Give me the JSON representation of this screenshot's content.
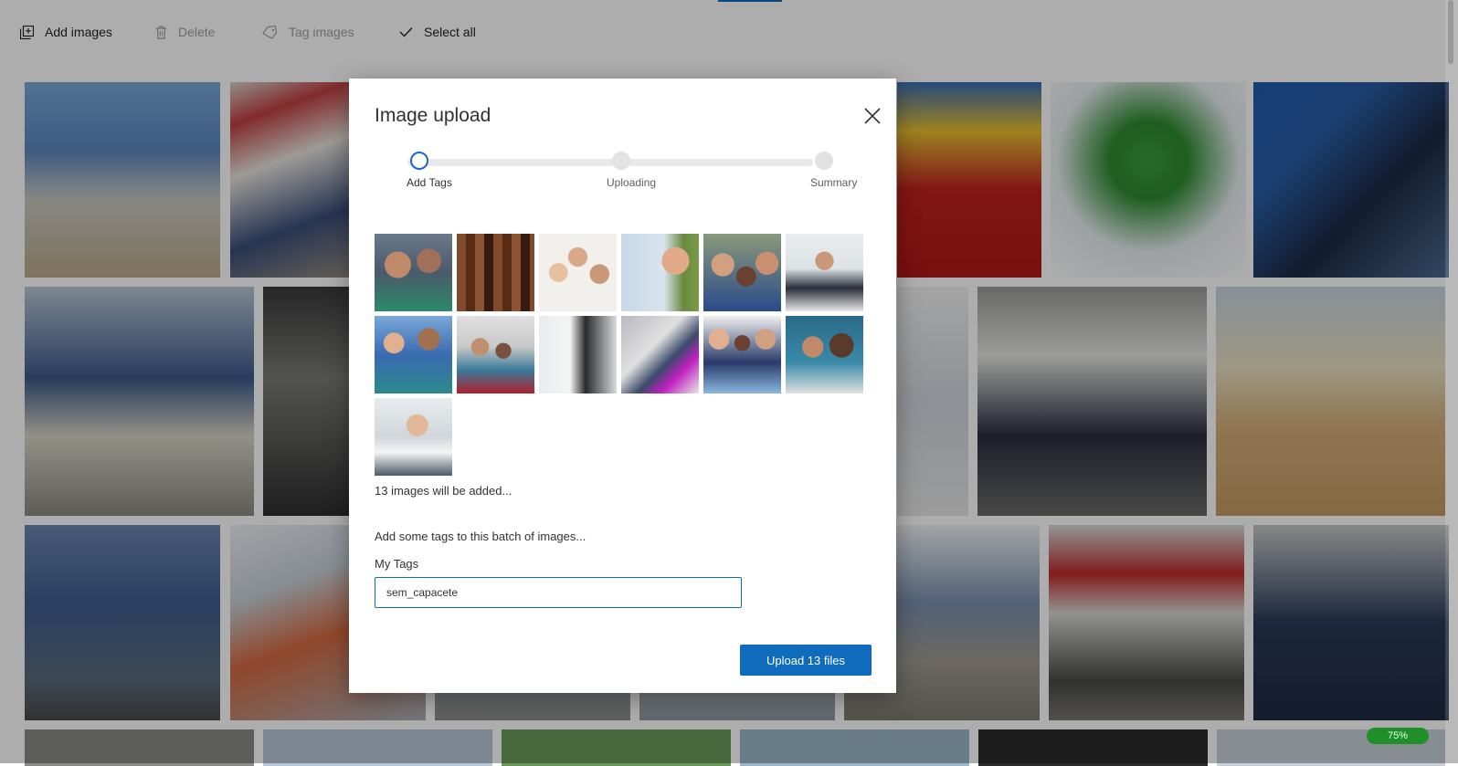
{
  "toolbar": {
    "add_images": "Add images",
    "delete": "Delete",
    "tag_images": "Tag images",
    "select_all": "Select all"
  },
  "dialog": {
    "title": "Image upload",
    "steps": [
      {
        "label": "Add Tags",
        "state": "active"
      },
      {
        "label": "Uploading",
        "state": "pending"
      },
      {
        "label": "Summary",
        "state": "pending"
      }
    ],
    "images_added_text": "13 images will be added...",
    "tags_prompt": "Add some tags to this batch of images...",
    "tags_label": "My Tags",
    "tags_value": "sem_capacete",
    "upload_button": "Upload 13 files"
  },
  "progress_badge": "75%",
  "colors": {
    "accent": "#0f6cbd",
    "badge": "#1f8f2a"
  },
  "icons": {
    "add_images": "add-images-icon",
    "delete": "trash-icon",
    "tag_images": "tag-icon",
    "select_all": "checkmark-icon",
    "close": "close-icon"
  }
}
